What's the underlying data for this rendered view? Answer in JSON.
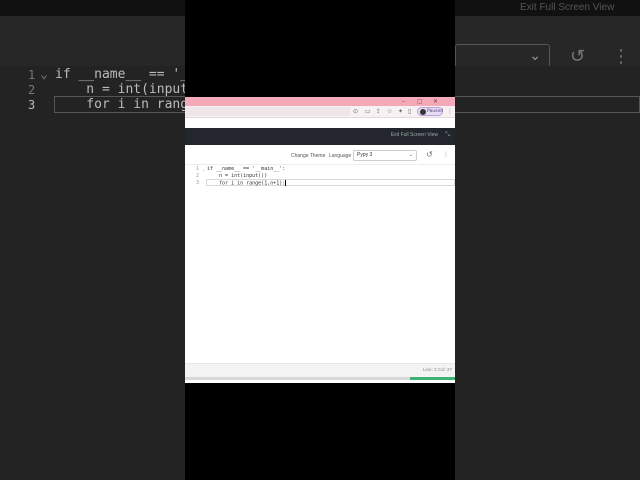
{
  "background": {
    "top_right_label": "Exit Full Screen View",
    "language_select": "",
    "code_lines": [
      {
        "num": "1",
        "text": "if __name__ == '__ma"
      },
      {
        "num": "2",
        "text": "    n = int(input()"
      },
      {
        "num": "3",
        "text": "    for i in range("
      }
    ]
  },
  "browser": {
    "window_controls": [
      "–",
      "▢",
      "✕"
    ],
    "profile_label": "Paused",
    "toolbar_icons": [
      "zoom-icon",
      "cast-icon",
      "share-icon",
      "star-icon",
      "extensions-icon",
      "sidepanel-icon",
      "menu-icon"
    ]
  },
  "editor": {
    "exit_fullscreen": "Exit Full Screen View",
    "change_theme": "Change Theme",
    "language_label": "Language",
    "language_value": "Pypy 3",
    "code_lines": [
      {
        "num": "1",
        "text": "if __name__ == '__main__':"
      },
      {
        "num": "2",
        "text": "    n = int(input())"
      },
      {
        "num": "3",
        "text": "    for i in range(1,n+1):"
      }
    ],
    "status": "Line: 3 Col: 27"
  },
  "colors": {
    "titlebar": "#f4a9b8",
    "dark_header": "#23262c",
    "progress": "#3cb371"
  }
}
